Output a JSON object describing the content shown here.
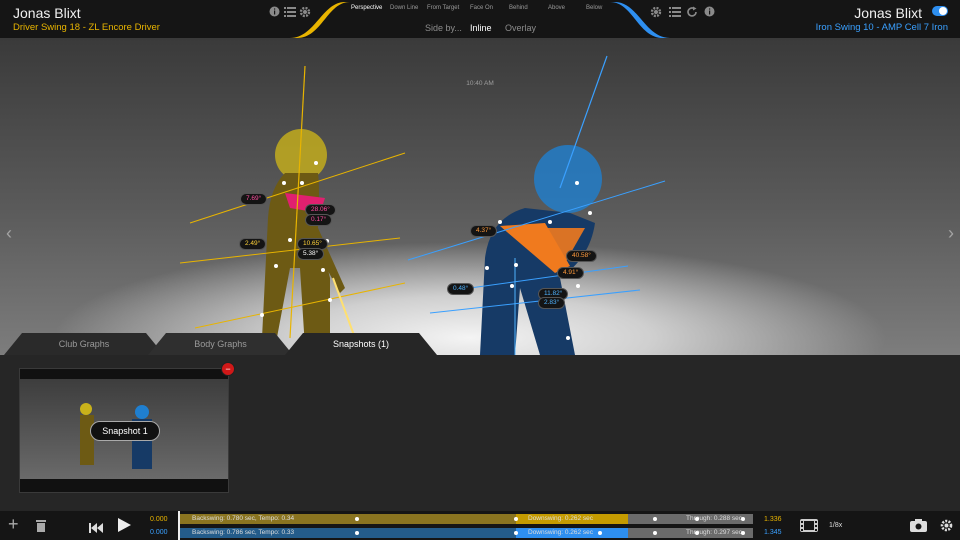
{
  "header": {
    "left_player": "Jonas Blixt",
    "left_swing": "Driver Swing 18 - ZL Encore Driver",
    "right_player": "Jonas Blixt",
    "right_swing": "Iron Swing 10 - AMP Cell 7 Iron",
    "views": [
      "Perspective",
      "Down Line",
      "From Target",
      "Face On",
      "Behind",
      "Above",
      "Below"
    ],
    "active_view": "Perspective",
    "modes": [
      "Side by...",
      "Inline",
      "Overlay"
    ],
    "active_mode": "Inline",
    "colors": {
      "left_accent": "#e8b400",
      "right_accent": "#3aa0ff"
    }
  },
  "viewer": {
    "time": "10:40 AM",
    "prev_icon": "chevron-left-icon",
    "next_icon": "chevron-right-icon",
    "angles_left": [
      "7.69°",
      "28.06°",
      "0.17°",
      "2.49°",
      "10.65°",
      "5.38°"
    ],
    "angles_right": [
      "4.37°",
      "40.58°",
      "4.91°",
      "0.48°",
      "11.82°",
      "2.83°"
    ]
  },
  "tabs": [
    "Club Graphs",
    "Body Graphs",
    "Snapshots (1)"
  ],
  "active_tab": "Snapshots (1)",
  "snapshots": [
    {
      "label": "Snapshot 1"
    }
  ],
  "timeline": {
    "left_start": "0.000",
    "right_start": "0.000",
    "left_end": "1.336",
    "right_end": "1.345",
    "speed": "1/8x",
    "top": {
      "backswing": "Backswing: 0.780 sec, Tempo: 0.34",
      "downswing": "Downswing: 0.262 sec",
      "through": "Through: 0.288 sec"
    },
    "bottom": {
      "backswing": "Backswing: 0.786 sec, Tempo: 0.33",
      "downswing": "Downswing: 0.262 sec",
      "through": "Through: 0.297 sec"
    }
  }
}
